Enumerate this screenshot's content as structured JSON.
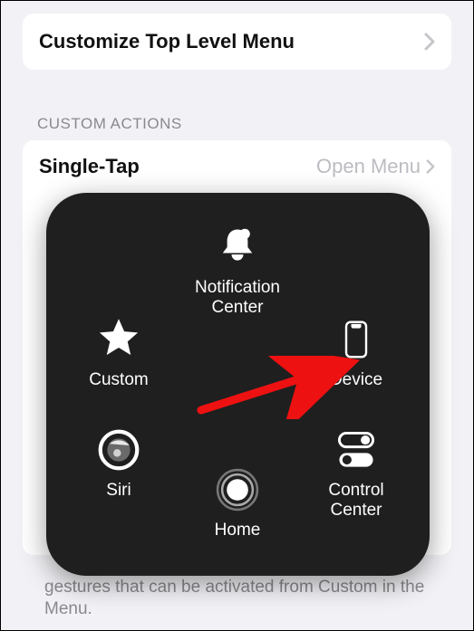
{
  "settings": {
    "row1_title": "Customize Top Level Menu",
    "section_header": "CUSTOM ACTIONS",
    "row2_title": "Single-Tap",
    "row2_value": "Open Menu",
    "footer": "gestures that can be activated from Custom in the Menu."
  },
  "menu": {
    "notification": "Notification Center",
    "custom": "Custom",
    "device": "Device",
    "siri": "Siri",
    "control": "Control Center",
    "home": "Home"
  }
}
